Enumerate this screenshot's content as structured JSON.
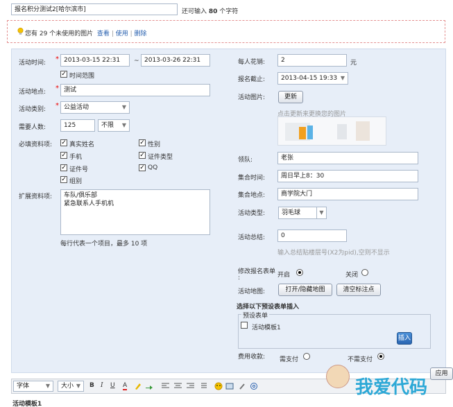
{
  "title_input": {
    "value": "报名积分测试2[哈尔滨市]",
    "remaining_prefix": "还可输入",
    "remaining_count": "80",
    "remaining_suffix": "个字符"
  },
  "notice": {
    "text": "您有 29 个未使用的图片",
    "view": "查看",
    "use": "使用",
    "delete": "删除",
    "sep": "|"
  },
  "left": {
    "time_label": "活动时间:",
    "start_time": "2013-03-15 22:31",
    "tilde": "~",
    "end_time": "2013-03-26 22:31",
    "time_range_label": "时间范围",
    "location_label": "活动地点:",
    "location_value": "测试",
    "category_label": "活动类别:",
    "category_value": "公益活动",
    "people_label": "需要人数:",
    "people_value": "125",
    "people_limit": "不限",
    "required_label": "必填资料项:",
    "required_items": [
      {
        "label": "真实姓名",
        "checked": true
      },
      {
        "label": "性别",
        "checked": true
      },
      {
        "label": "手机",
        "checked": true
      },
      {
        "label": "证件类型",
        "checked": true
      },
      {
        "label": "证件号",
        "checked": true
      },
      {
        "label": "QQ",
        "checked": true
      },
      {
        "label": "组别",
        "checked": true
      }
    ],
    "extend_label": "扩展资料项:",
    "extend_line1": "车队/俱乐部",
    "extend_line2": "紧急联系人手机机",
    "extend_hint": "每行代表一个项目，最多 10 项"
  },
  "right": {
    "cost_label": "每人花销:",
    "cost_value": "2",
    "cost_unit": "元",
    "deadline_label": "报名截止:",
    "deadline_value": "2013-04-15 19:33",
    "image_label": "活动图片:",
    "update_button": "更新",
    "image_hint": "点击更新来更换您的图片",
    "leader_label": "领队:",
    "leader_value": "老张",
    "gather_time_label": "集合时间:",
    "gather_time_value": "周日早上8：30",
    "gather_place_label": "集合地点:",
    "gather_place_value": "商学院大门",
    "type_label": "活动类型:",
    "type_value": "羽毛球",
    "summary_label": "活动总结:",
    "summary_value": "0",
    "summary_hint": "输入总结贴楼层号(X2为pid),空则不显示",
    "modify_form_label": "修改报名表单",
    "modify_form_colon": ":",
    "open_label": "开启",
    "close_label": "关闭",
    "map_label": "活动地图:",
    "map_toggle_button": "打开/隐藏地图",
    "map_clear_button": "清空标注点",
    "preset_title": "选择以下预设表单插入",
    "preset_legend": "预设表单",
    "preset_item": "活动模板1",
    "insert_button": "插入",
    "fee_label": "费用收款:",
    "fee_pay": "需支付",
    "fee_nopay": "不需支付"
  },
  "editor": {
    "font_label": "字体",
    "size_label": "大小",
    "bold": "B",
    "italic": "I",
    "underline": "U",
    "color": "A",
    "content_title": "活动模板1"
  },
  "watermark": {
    "text": "我爱代码",
    "side_button": "应用"
  }
}
